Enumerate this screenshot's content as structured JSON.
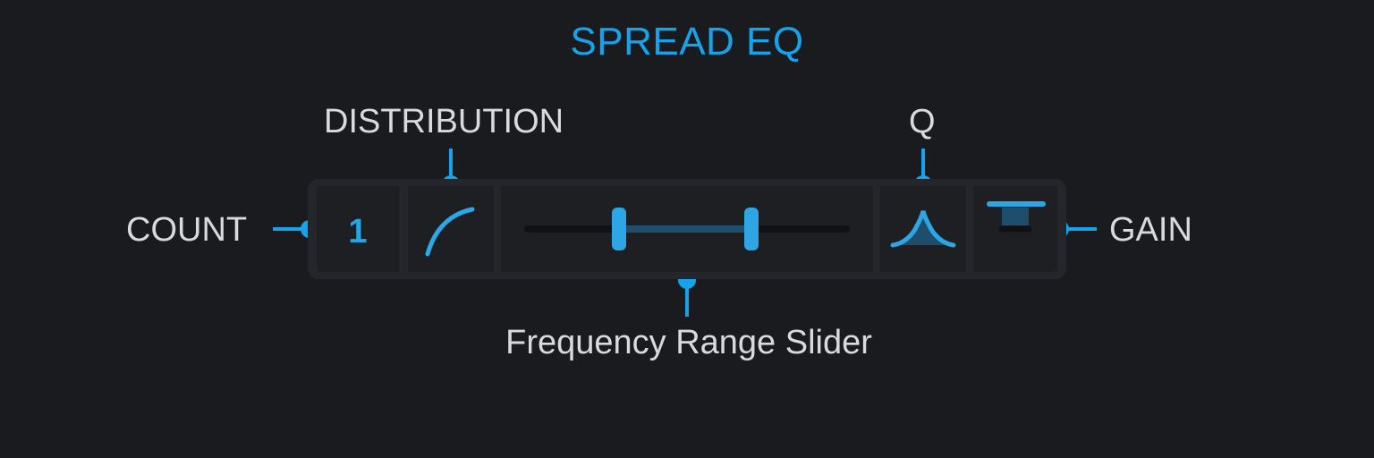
{
  "title": "SPREAD EQ",
  "labels": {
    "distribution": "DISTRIBUTION",
    "q": "Q",
    "count": "COUNT",
    "gain": "GAIN",
    "frequency_range": "Frequency Range Slider"
  },
  "controls": {
    "count_value": "1",
    "distribution_icon": "curve-icon",
    "q_icon": "bell-curve-icon",
    "gain_icon": "gain-bar-icon"
  },
  "colors": {
    "accent": "#16a3ec",
    "background": "#1a1b1f",
    "panel": "#24262b",
    "text": "#d8dadd"
  }
}
